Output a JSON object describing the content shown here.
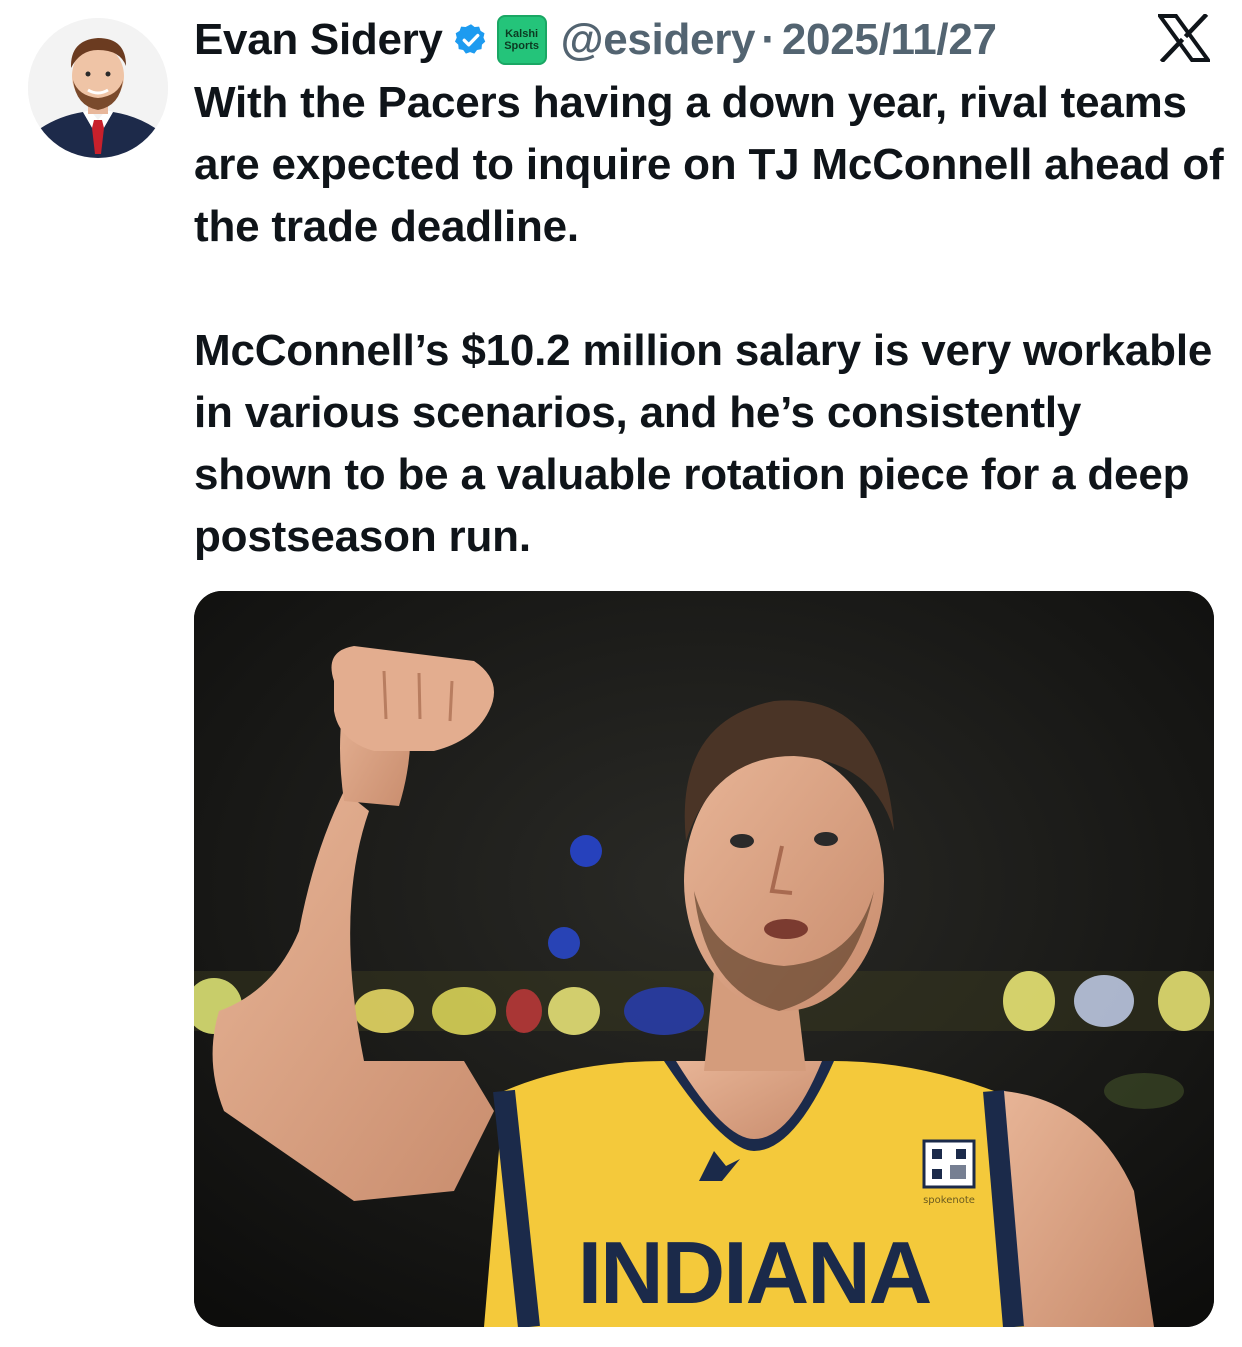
{
  "author": {
    "name": "Evan Sidery",
    "handle": "@esidery",
    "separator": "·",
    "date": "2025/11/27",
    "affiliation_badge": {
      "line1": "Kalshi",
      "line2": "Sports",
      "color": "#24c47a"
    },
    "verified_color": "#1d9bf0"
  },
  "platform": {
    "logo": "x-logo-icon"
  },
  "tweet": {
    "paragraph1": "With the Pacers having a down year, rival teams are expected to inquire on TJ McConnell ahead of the trade deadline.",
    "paragraph2": "McConnell’s $10.2 million salary is very workable in various scenarios, and he’s consistently shown to be a valuable rotation piece for a deep postseason run."
  },
  "media": {
    "jersey_text": "INDIANA",
    "jersey_sponsor": "spokenote",
    "jersey_color": "#f4c93b",
    "trim_color": "#1b2a4a"
  }
}
